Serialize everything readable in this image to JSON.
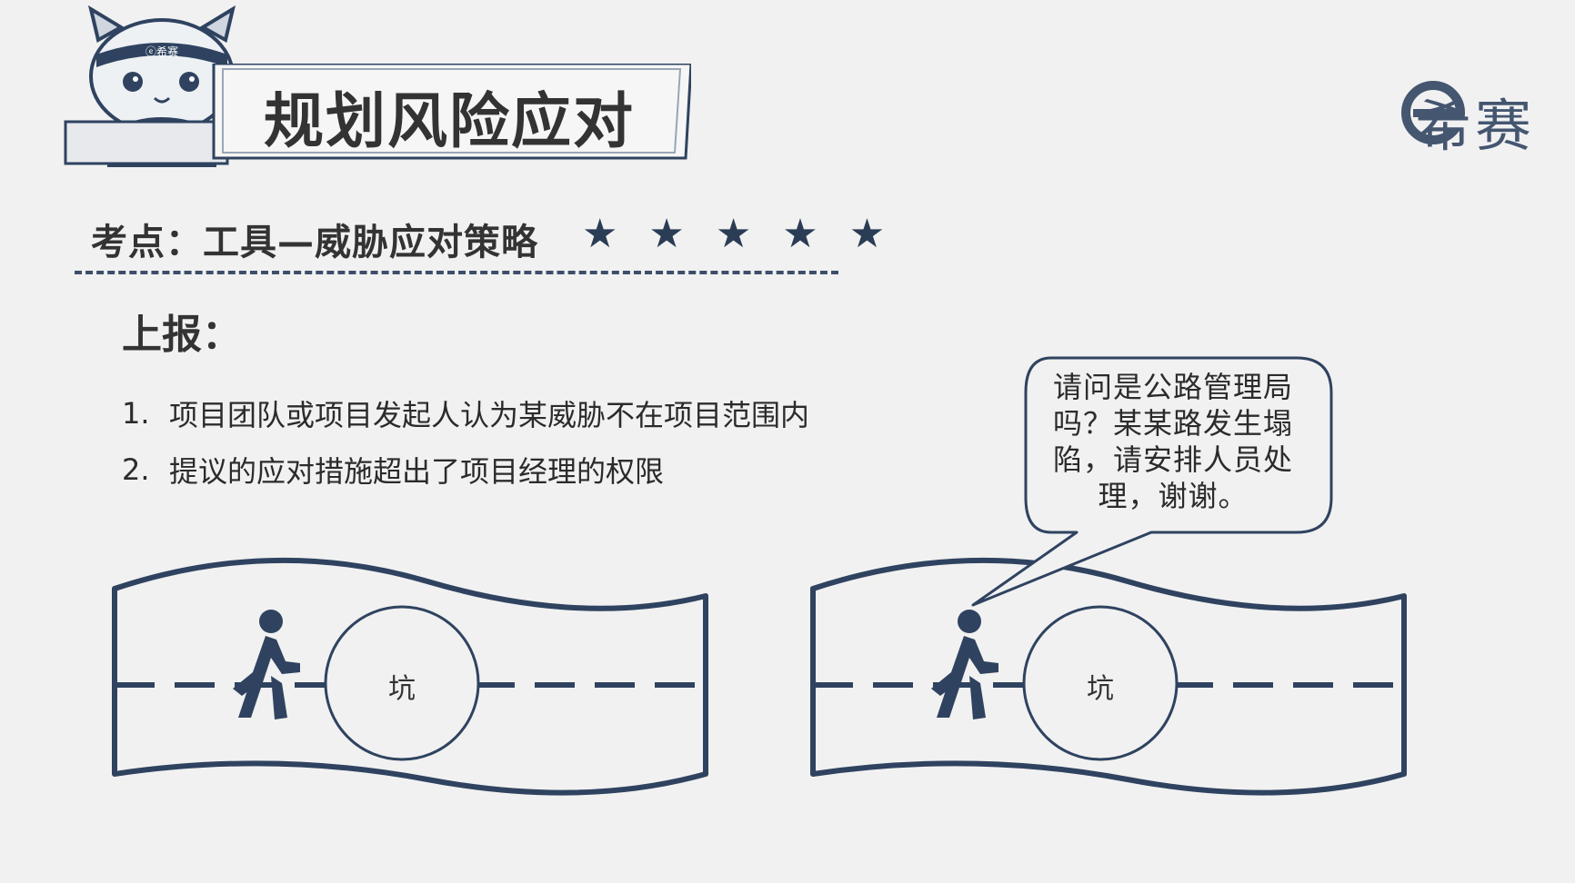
{
  "header": {
    "title": "规划风险应对",
    "mascot_badge": "ⓔ希赛",
    "logo_text": "希赛",
    "logo_icon": "e-circle-logo-icon"
  },
  "keypoint": {
    "label": "考点：工具—威胁应对策略",
    "stars": "★ ★ ★ ★ ★",
    "rating": 5
  },
  "section": {
    "heading": "上报：",
    "items": [
      {
        "num": "1.",
        "text": "项目团队或项目发起人认为某威胁不在项目范围内"
      },
      {
        "num": "2.",
        "text": "提议的应对措施超出了项目经理的权限"
      }
    ]
  },
  "illustrations": {
    "left_pit_label": "坑",
    "right_pit_label": "坑",
    "bubble_text": "请问是公路管理局吗？某某路发生塌陷，请安排人员处理，谢谢。",
    "stroke_color": "#2f4360"
  }
}
